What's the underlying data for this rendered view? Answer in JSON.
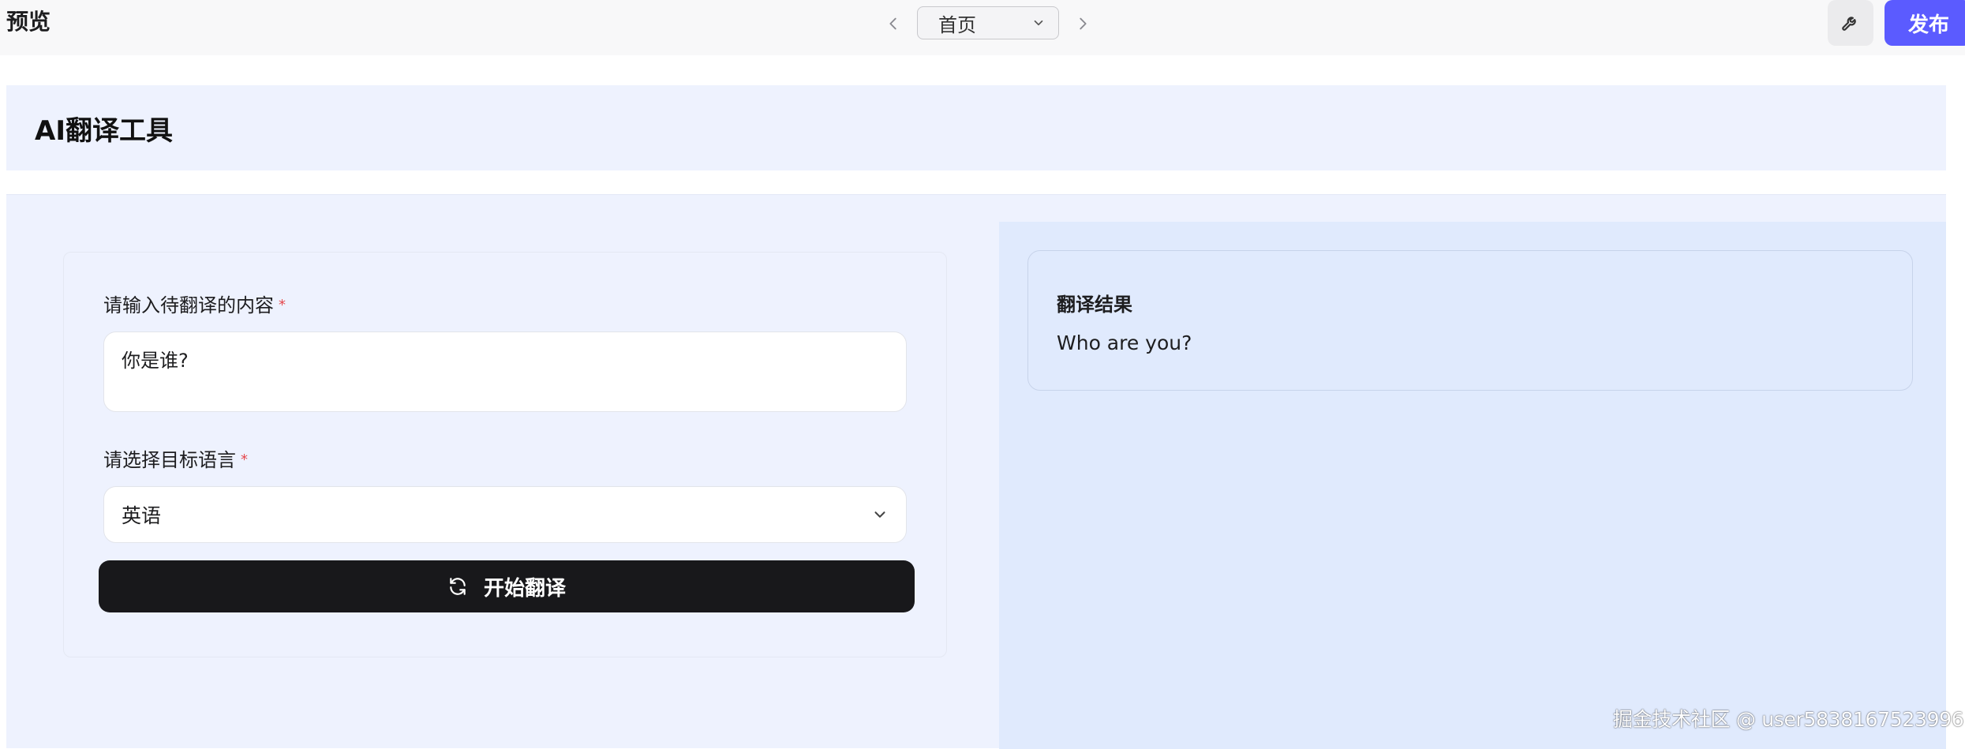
{
  "topbar": {
    "title": "预览",
    "page_select": {
      "value": "首页"
    },
    "publish_label": "发布"
  },
  "header": {
    "app_title": "AI翻译工具"
  },
  "form": {
    "content_label": "请输入待翻译的内容",
    "content_required": "*",
    "content_value": "你是谁?",
    "language_label": "请选择目标语言",
    "language_required": "*",
    "language_value": "英语",
    "submit_label": "开始翻译"
  },
  "result": {
    "title": "翻译结果",
    "text": "Who are you?"
  },
  "watermark": "掘金技术社区 @ user5838167523996",
  "colors": {
    "accent": "#5b5bff",
    "panel_bg": "#eef2fe",
    "result_bg": "#e0eafd",
    "button_dark": "#18181b",
    "required": "#e5484d"
  },
  "icons": {
    "prev": "chevron-left-icon",
    "next": "chevron-right-icon",
    "dropdown": "chevron-down-icon",
    "settings": "wrench-icon",
    "submit": "refresh-icon"
  }
}
